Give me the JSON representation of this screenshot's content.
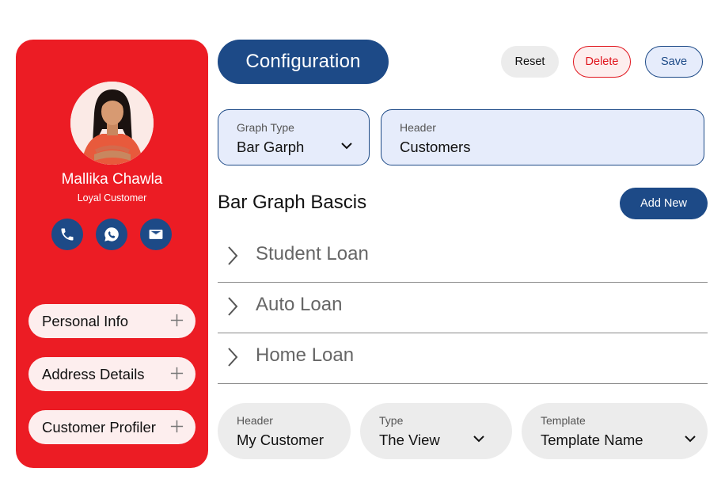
{
  "profile": {
    "name": "Mallika Chawla",
    "role": "Loyal Customer"
  },
  "contacts": [
    {
      "icon": "phone-icon"
    },
    {
      "icon": "whatsapp-icon"
    },
    {
      "icon": "mail-icon"
    }
  ],
  "sidebar": {
    "items": [
      {
        "label": "Personal Info"
      },
      {
        "label": "Address Details"
      },
      {
        "label": "Customer Profiler"
      }
    ]
  },
  "header": {
    "title": "Configuration",
    "reset_label": "Reset",
    "delete_label": "Delete",
    "save_label": "Save"
  },
  "config": {
    "graph_type": {
      "label": "Graph Type",
      "value": "Bar Garph"
    },
    "header": {
      "label": "Header",
      "value": "Customers"
    }
  },
  "section": {
    "title": "Bar Graph Bascis",
    "add_label": "Add New",
    "items": [
      {
        "label": "Student Loan"
      },
      {
        "label": "Auto Loan"
      },
      {
        "label": "Home Loan"
      }
    ]
  },
  "bottom": {
    "header": {
      "label": "Header",
      "value": "My Customer"
    },
    "type": {
      "label": "Type",
      "value": "The View"
    },
    "template": {
      "label": "Template",
      "value": "Template Name"
    }
  },
  "colors": {
    "sidebar": "#ec1c24",
    "primary": "#1d4a87",
    "field_bg": "#e6ecfb",
    "danger": "#e0141c"
  }
}
